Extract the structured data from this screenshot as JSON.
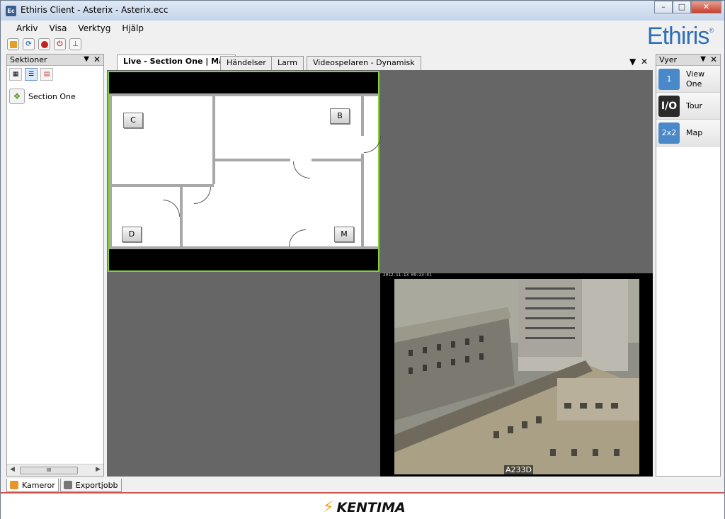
{
  "window": {
    "title": "Ethiris Client - Asterix - Asterix.ecc",
    "app_icon": "Ec",
    "controls": [
      "minimize-icon",
      "maximize-icon",
      "close-icon"
    ]
  },
  "menu": {
    "items": [
      "Arkiv",
      "Visa",
      "Verktyg",
      "Hjälp"
    ]
  },
  "toolbar": {
    "icons": [
      "folder-icon",
      "refresh-icon",
      "record-icon",
      "power-icon",
      "anchor-icon"
    ]
  },
  "brand": {
    "logo": "Ethiris",
    "logo_mark": "®",
    "color": "#2f6fb6"
  },
  "sections_panel": {
    "title": "Sektioner",
    "items": [
      {
        "label": "Section One",
        "icon": "section-icon"
      }
    ],
    "scroll_thumb": "III"
  },
  "tabs": [
    {
      "label": "Live - Section One | Map",
      "active": true
    },
    {
      "label": "Händelser",
      "active": false
    },
    {
      "label": "Larm",
      "active": false
    },
    {
      "label": "Videospelaren - Dynamisk",
      "active": false
    }
  ],
  "map": {
    "cameras": [
      "C",
      "B",
      "D",
      "M"
    ],
    "highlight_color": "#7fd23b"
  },
  "camera_view": {
    "timestamp": "2012-11-13 09:23:41",
    "label": "A233D"
  },
  "views_panel": {
    "title": "Vyer",
    "items": [
      {
        "label_line1": "View",
        "label_line2": "One",
        "icon_text": "1"
      },
      {
        "label_line1": "Tour",
        "label_line2": "",
        "icon_text": "I/O"
      },
      {
        "label_line1": "Map",
        "label_line2": "",
        "icon_text": "2x2"
      }
    ]
  },
  "bottom_tabs": [
    {
      "label": "Kameror",
      "active": true
    },
    {
      "label": "Exportjobb",
      "active": false
    }
  ],
  "footer": {
    "brand": "KENTIMA",
    "accent": "#c95454"
  }
}
